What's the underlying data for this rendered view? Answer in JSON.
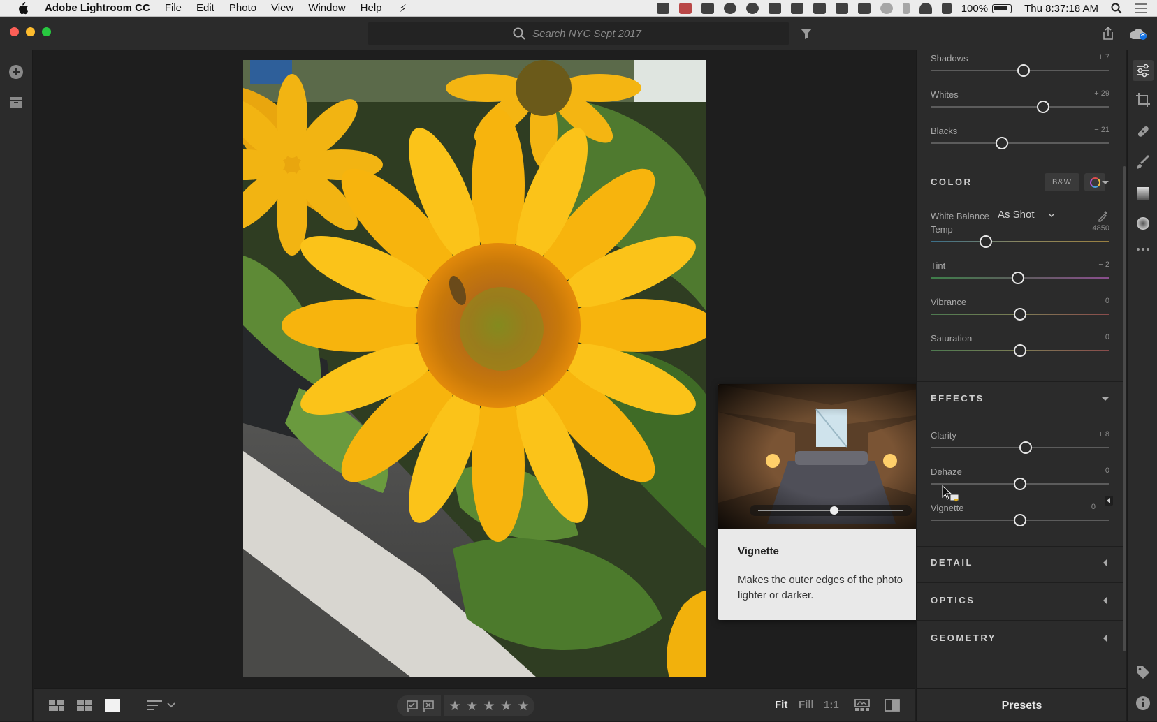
{
  "menubar": {
    "app_name": "Adobe Lightroom CC",
    "items": [
      "File",
      "Edit",
      "Photo",
      "View",
      "Window",
      "Help"
    ],
    "battery": "100%",
    "clock": "Thu 8:37:18 AM"
  },
  "search": {
    "placeholder": "Search NYC Sept 2017"
  },
  "light": {
    "shadows": {
      "label": "Shadows",
      "value": "+ 7",
      "position": 0.52
    },
    "whites": {
      "label": "Whites",
      "value": "+ 29",
      "position": 0.63
    },
    "blacks": {
      "label": "Blacks",
      "value": "− 21",
      "position": 0.4
    }
  },
  "color": {
    "title": "COLOR",
    "bw_label": "B&W",
    "white_balance_label": "White Balance",
    "white_balance_value": "As Shot",
    "temp": {
      "label": "Temp",
      "value": "4850",
      "position": 0.31
    },
    "tint": {
      "label": "Tint",
      "value": "− 2",
      "position": 0.49
    },
    "vibrance": {
      "label": "Vibrance",
      "value": "0",
      "position": 0.5
    },
    "saturation": {
      "label": "Saturation",
      "value": "0",
      "position": 0.5
    }
  },
  "effects": {
    "title": "EFFECTS",
    "clarity": {
      "label": "Clarity",
      "value": "+ 8",
      "position": 0.53
    },
    "dehaze": {
      "label": "Dehaze",
      "value": "0",
      "position": 0.5
    },
    "vignette": {
      "label": "Vignette",
      "value": "0",
      "position": 0.5
    }
  },
  "sections": {
    "detail": "DETAIL",
    "optics": "OPTICS",
    "geometry": "GEOMETRY"
  },
  "tooltip": {
    "title": "Vignette",
    "description": "Makes the outer edges of the photo lighter or darker."
  },
  "bottom": {
    "zoom_fit": "Fit",
    "zoom_fill": "Fill",
    "zoom_11": "1:1",
    "stars": [
      "★",
      "★",
      "★",
      "★",
      "★"
    ],
    "presets": "Presets"
  },
  "colors": {
    "panel_bg": "#2b2b2b",
    "canvas_bg": "#1e1e1e",
    "accent_blue": "#1473e6"
  }
}
